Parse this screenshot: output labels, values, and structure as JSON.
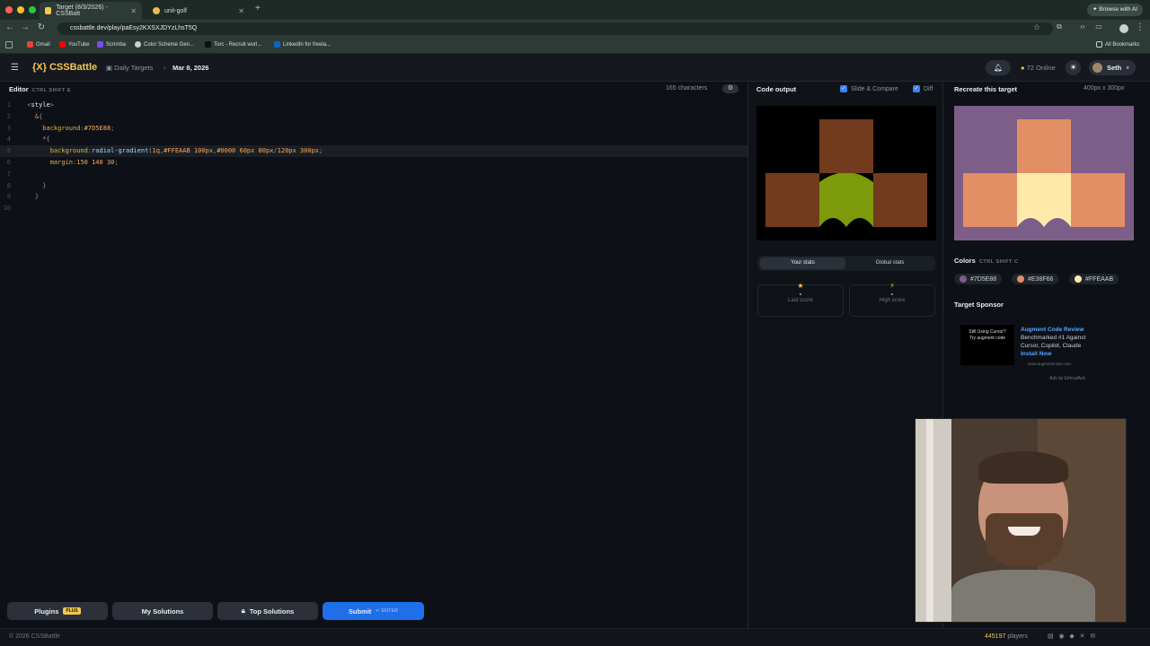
{
  "browser": {
    "tabs": [
      {
        "title": "Target (8/3/2026) - CSSBatt",
        "active": true
      },
      {
        "title": "unit-golf",
        "active": false
      }
    ],
    "url": "cssbattle.dev/play/paEsy2KXSXJDYzLhsT5Q",
    "browse_ai": "Browse with AI",
    "bookmarks": [
      "Gmail",
      "YouTube",
      "Scrimba",
      "Color Scheme Gen...",
      "Torc - Recruit worl...",
      "LinkedIn for freela..."
    ],
    "all_bookmarks": "All Bookmarks"
  },
  "header": {
    "logo": "{X} CSSBattle",
    "crumb_section": "Daily Targets",
    "crumb_date": "Mar 8, 2026",
    "online_count": "72",
    "online_label": "Online",
    "user": "Seth"
  },
  "editor": {
    "title": "Editor",
    "shortcut": "CTRL  SHIFT  E",
    "char_count": "165 characters",
    "line_numbers": [
      "1",
      "2",
      "3",
      "4",
      "5",
      "6",
      "7",
      "8",
      "9",
      "10"
    ]
  },
  "buttons": {
    "plugins": "Plugins",
    "plugins_badge": "PLUS",
    "my_solutions": "My Solutions",
    "top_solutions": "Top Solutions",
    "submit": "Submit",
    "submit_hint": "ENTER"
  },
  "output": {
    "title": "Code output",
    "slide_compare": "Slide & Compare",
    "diff": "Diff",
    "your_stats": "Your stats",
    "global_stats": "Global stats",
    "last_score_value": "-",
    "last_score_label": "Last score",
    "high_score_value": "-",
    "high_score_label": "High score"
  },
  "target": {
    "title": "Recreate this target",
    "size": "400px x 300px",
    "colors_title": "Colors",
    "colors_shortcut": "CTRL  SHIFT  C",
    "colors": [
      {
        "hex": "#7D5E88"
      },
      {
        "hex": "#E38F66"
      },
      {
        "hex": "#FFEAAB"
      }
    ],
    "sponsor_title": "Target Sponsor",
    "sponsor_img_line1": "Still Using Cursor?",
    "sponsor_img_line2": "Try augment code",
    "sponsor_name": "Augment Code Review",
    "sponsor_body": "Benchmarked #1 Against Cursor, Copilot, Claude",
    "sponsor_cta": "Install Now",
    "sponsor_url": "www.augmentcode.com",
    "sponsor_ads": "Ads by EthicalAds"
  },
  "footer": {
    "copyright": "© 2026 CSSBattle",
    "players_count": "445197",
    "players_label": "players"
  }
}
